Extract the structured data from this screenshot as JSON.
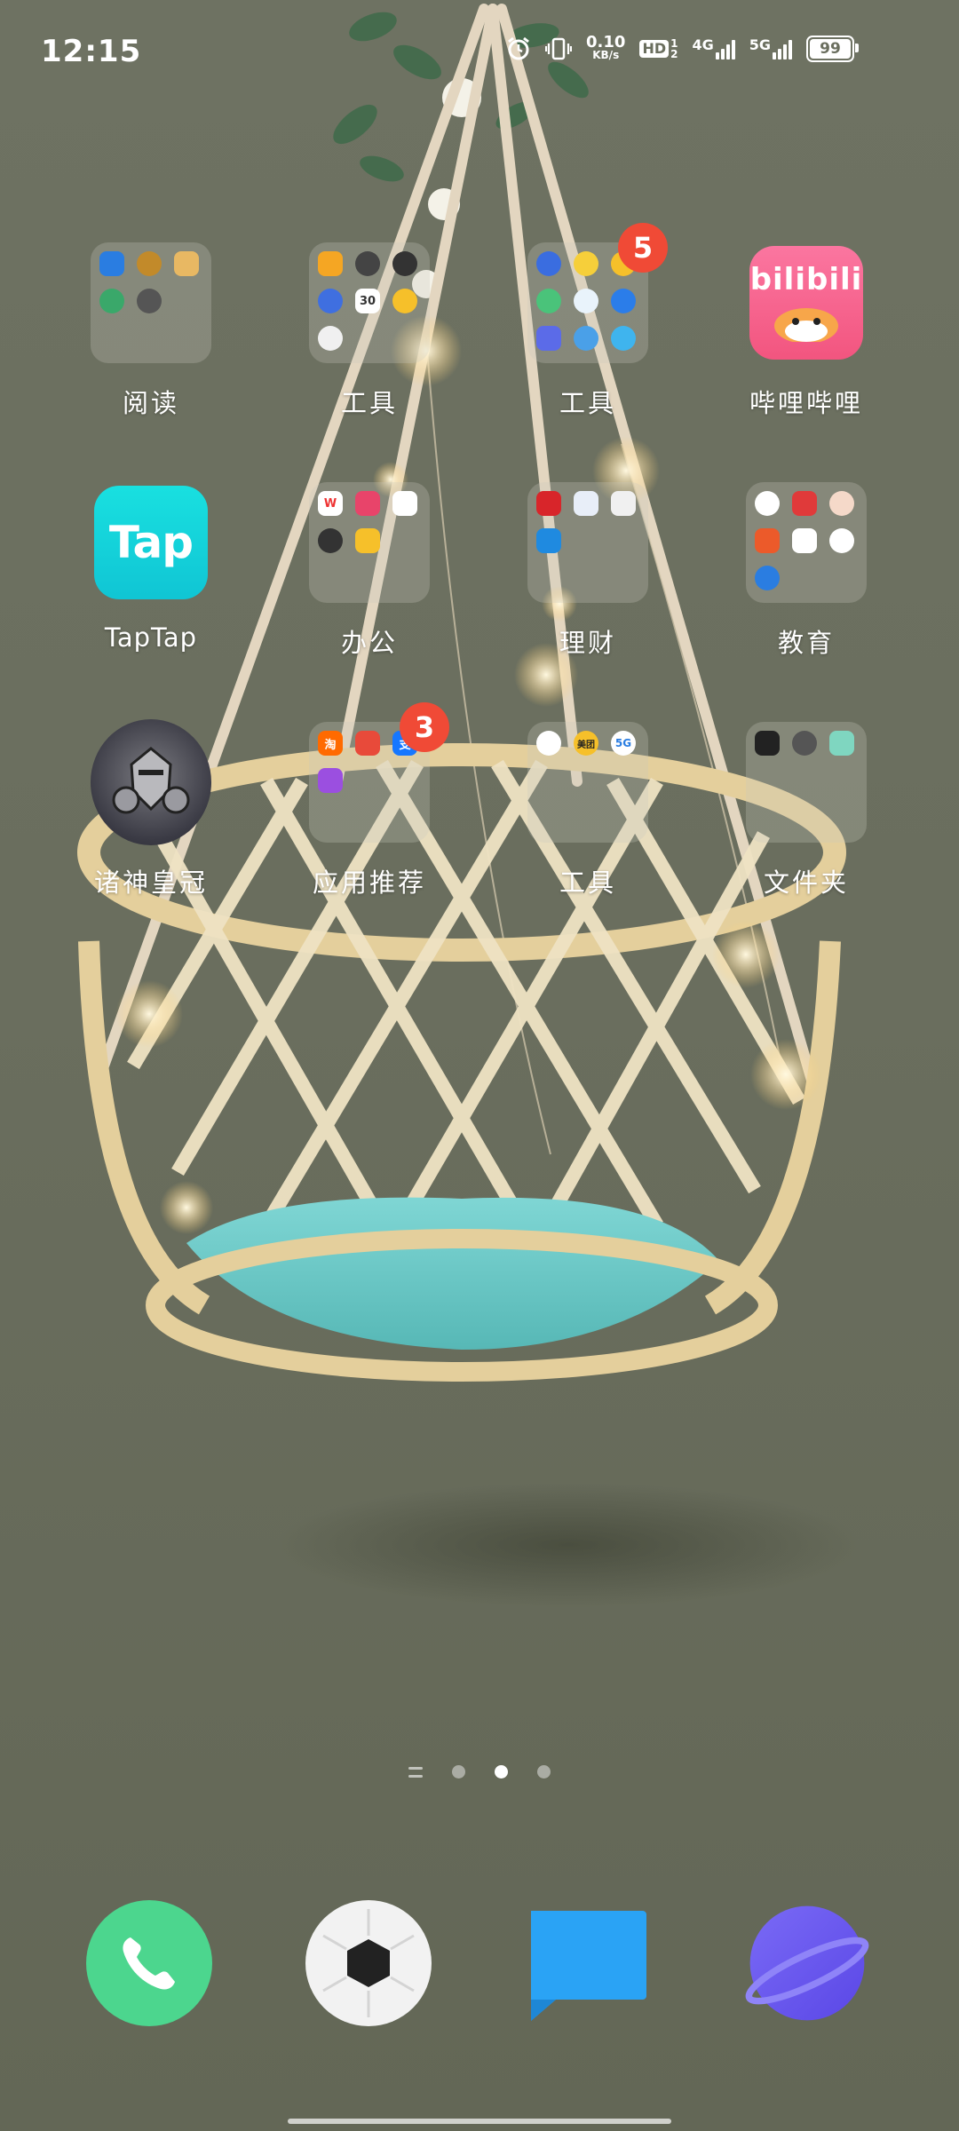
{
  "status_bar": {
    "time": "12:15",
    "net_speed_value": "0.10",
    "net_speed_unit": "KB/s",
    "hd_label": "HD",
    "hd_sub_top": "1",
    "hd_sub_bottom": "2",
    "net1": "4G",
    "net2": "5G",
    "battery": "99",
    "icons": [
      "alarm-icon",
      "vibrate-icon",
      "signal-icon",
      "battery-icon"
    ]
  },
  "apps": {
    "row1": [
      {
        "name": "阅读",
        "kind": "folder"
      },
      {
        "name": "工具",
        "kind": "folder"
      },
      {
        "name": "工具",
        "kind": "folder",
        "badge": "5"
      },
      {
        "name": "哔哩哔哩",
        "kind": "app",
        "logo_text": "bilibili"
      }
    ],
    "row2": [
      {
        "name": "TapTap",
        "kind": "app",
        "logo_text": "Tap"
      },
      {
        "name": "办公",
        "kind": "folder"
      },
      {
        "name": "理财",
        "kind": "folder"
      },
      {
        "name": "教育",
        "kind": "folder"
      }
    ],
    "row3": [
      {
        "name": "诸神皇冠",
        "kind": "app"
      },
      {
        "name": "应用推荐",
        "kind": "folder",
        "badge": "3"
      },
      {
        "name": "工具",
        "kind": "folder"
      },
      {
        "name": "文件夹",
        "kind": "folder"
      }
    ]
  },
  "mini_icon_text": {
    "taobao": "淘",
    "meituan": "美团",
    "fiveg": "5G",
    "wps": "W",
    "alipay": "支",
    "calendar": "30"
  },
  "pager": {
    "pages": 3,
    "active_index": 1
  },
  "dock": [
    {
      "name": "phone",
      "icon": "phone-icon",
      "color": "#4cd68e"
    },
    {
      "name": "camera",
      "icon": "camera-icon",
      "color": "#f2f2f2"
    },
    {
      "name": "messages",
      "icon": "message-icon",
      "color": "#2aa3f5"
    },
    {
      "name": "browser",
      "icon": "planet-icon",
      "color": "#6a5af0"
    }
  ]
}
